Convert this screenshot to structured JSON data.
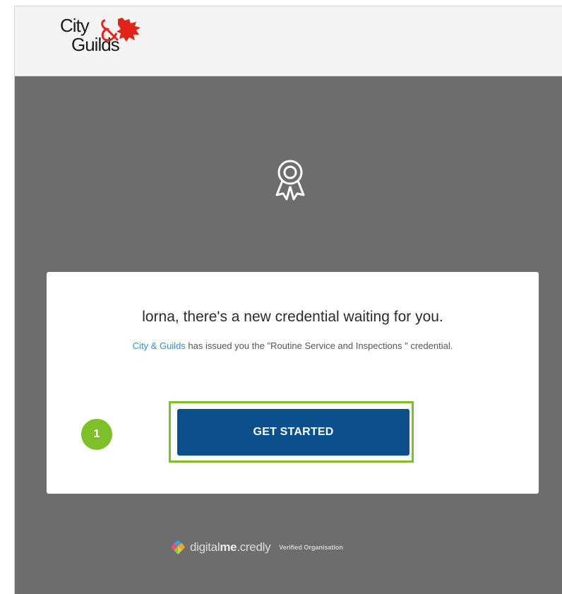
{
  "header": {
    "logo_line1": "City",
    "logo_line2": "Guilds"
  },
  "card": {
    "headline": "lorna, there's a new credential waiting for you.",
    "issuer_link": "City & Guilds",
    "issued_text": " has issued you the \"Routine Service and Inspections \" credential.",
    "button_label": "GET STARTED"
  },
  "annotation": {
    "step_number": "1"
  },
  "footer": {
    "brand_part1": "digital",
    "brand_part2": "me",
    "brand_part3": ".credly",
    "verified": "Verified Organisation"
  },
  "colors": {
    "accent_green": "#7fbf2a",
    "button_blue": "#0b4f8c",
    "link_blue": "#2f8fd0",
    "logo_red": "#e2231a"
  },
  "icons": {
    "badge": "award-ribbon-icon",
    "brand": "digitalme-logo-icon"
  }
}
